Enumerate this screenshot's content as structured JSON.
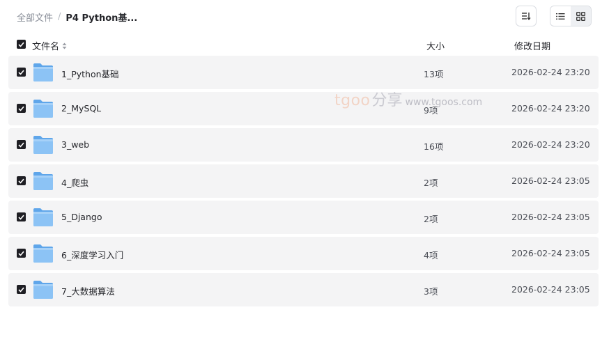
{
  "breadcrumb": {
    "root": "全部文件",
    "separator": "/",
    "current": "P4 Python基..."
  },
  "toolbar": {
    "sort_icon": "sort-descending-icon",
    "view_list_icon": "list-view-icon",
    "view_grid_icon": "grid-view-icon",
    "active_view": "grid"
  },
  "header": {
    "name": "文件名",
    "size": "大小",
    "date": "修改日期"
  },
  "rows": [
    {
      "name": "1_Python基础",
      "size": "13项",
      "date": "2026-02-24 23:20"
    },
    {
      "name": "2_MySQL",
      "size": "9项",
      "date": "2026-02-24 23:20"
    },
    {
      "name": "3_web",
      "size": "16项",
      "date": "2026-02-24 23:20"
    },
    {
      "name": "4_爬虫",
      "size": "2项",
      "date": "2026-02-24 23:05"
    },
    {
      "name": "5_Django",
      "size": "2项",
      "date": "2026-02-24 23:05"
    },
    {
      "name": "6_深度学习入门",
      "size": "4项",
      "date": "2026-02-24 23:05"
    },
    {
      "name": "7_大数据算法",
      "size": "3项",
      "date": "2026-02-24 23:05"
    }
  ],
  "watermark": {
    "brand": "tgoo",
    "share": "分享",
    "url": "www.tgoos.com"
  },
  "colors": {
    "row_bg": "#f4f4f5",
    "checkbox": "#1f1f24",
    "folder": "#7fbaf2"
  }
}
